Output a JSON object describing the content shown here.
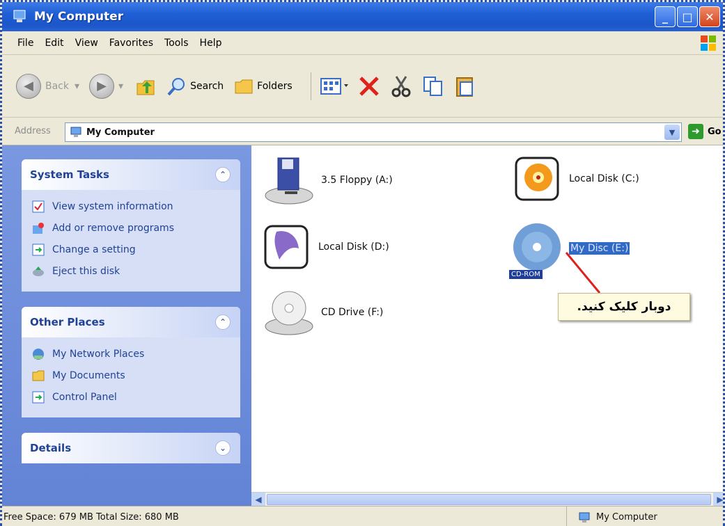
{
  "window": {
    "title": "My Computer"
  },
  "menu": [
    "File",
    "Edit",
    "View",
    "Favorites",
    "Tools",
    "Help"
  ],
  "toolbar": {
    "back_label": "Back",
    "search_label": "Search",
    "folders_label": "Folders"
  },
  "address": {
    "label": "Address",
    "value": "My Computer",
    "go_label": "Go"
  },
  "system_tasks": {
    "title": "System Tasks",
    "items": [
      "View system information",
      "Add or remove programs",
      "Change a setting",
      "Eject this disk"
    ]
  },
  "other_places": {
    "title": "Other Places",
    "items": [
      "My Network Places",
      "My Documents",
      "Control Panel"
    ]
  },
  "details": {
    "title": "Details"
  },
  "drives": {
    "floppy": "3.5 Floppy (A:)",
    "c": "Local Disk (C:)",
    "d": "Local Disk (D:)",
    "e": "My Disc (E:)",
    "e_tag": "CD-ROM",
    "f": "CD Drive (F:)"
  },
  "callout": {
    "text": "دوبار کلیک کنید."
  },
  "status": {
    "left": "Free Space: 679 MB Total Size: 680 MB",
    "right": "My Computer"
  }
}
